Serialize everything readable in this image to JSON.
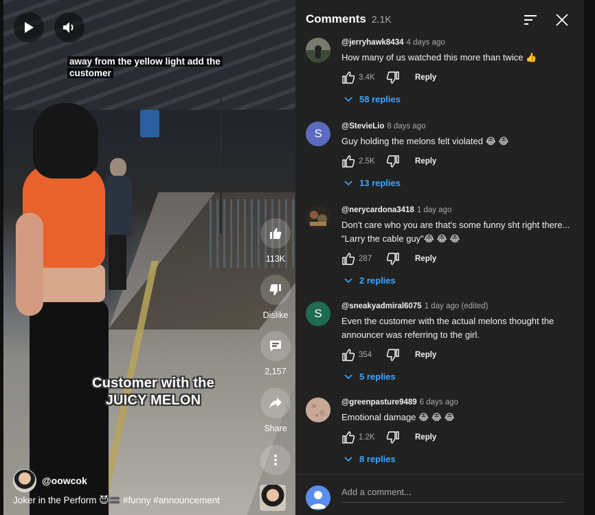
{
  "video": {
    "caption": "away from the yellow light add the customer",
    "overlay_text": "Customer with the JUICY MELON",
    "channel": "@oowcok",
    "description": "Joker in the Perform 😈🟰 #funny #announcement",
    "like_count": "113K",
    "dislike_label": "Dislike",
    "comment_count": "2,157",
    "share_label": "Share",
    "controls": {
      "play_icon": "play-icon",
      "volume_icon": "volume-icon",
      "more_icon": "more-vert-icon"
    }
  },
  "comments_panel": {
    "title": "Comments",
    "count": "2.1K",
    "reply_label": "Reply",
    "add_placeholder": "Add a comment...",
    "items": [
      {
        "user": "@jerryhawk8434",
        "time": "4 days ago",
        "text": "How many of us watched this more than twice 👍",
        "likes": "3.4K",
        "replies": "58 replies",
        "avatar_letter": "",
        "avatar_color": "#3a3a3a"
      },
      {
        "user": "@StevieLio",
        "time": "8 days ago",
        "text": "Guy holding the melons felt violated 😂 😂",
        "likes": "2.5K",
        "replies": "13 replies",
        "avatar_letter": "S",
        "avatar_color": "#5c6bc0"
      },
      {
        "user": "@nerycardona3418",
        "time": "1 day ago",
        "text": "Don't care who you are that's some funny sht right there... \"Larry the cable guy\"😂 😂 😂",
        "likes": "287",
        "replies": "2 replies",
        "avatar_letter": "",
        "avatar_color": "#4a3a2a"
      },
      {
        "user": "@sneakyadmiral6075",
        "time": "1 day ago (edited)",
        "text": "Even the customer with the actual melons thought the announcer was referring to the girl.",
        "likes": "354",
        "replies": "5 replies",
        "avatar_letter": "S",
        "avatar_color": "#1e6b50"
      },
      {
        "user": "@greenpasture9489",
        "time": "6 days ago",
        "text": "Emotional damage 😂 😂 😂",
        "likes": "1.2K",
        "replies": "8 replies",
        "avatar_letter": "",
        "avatar_color": "#c9a898"
      }
    ]
  }
}
